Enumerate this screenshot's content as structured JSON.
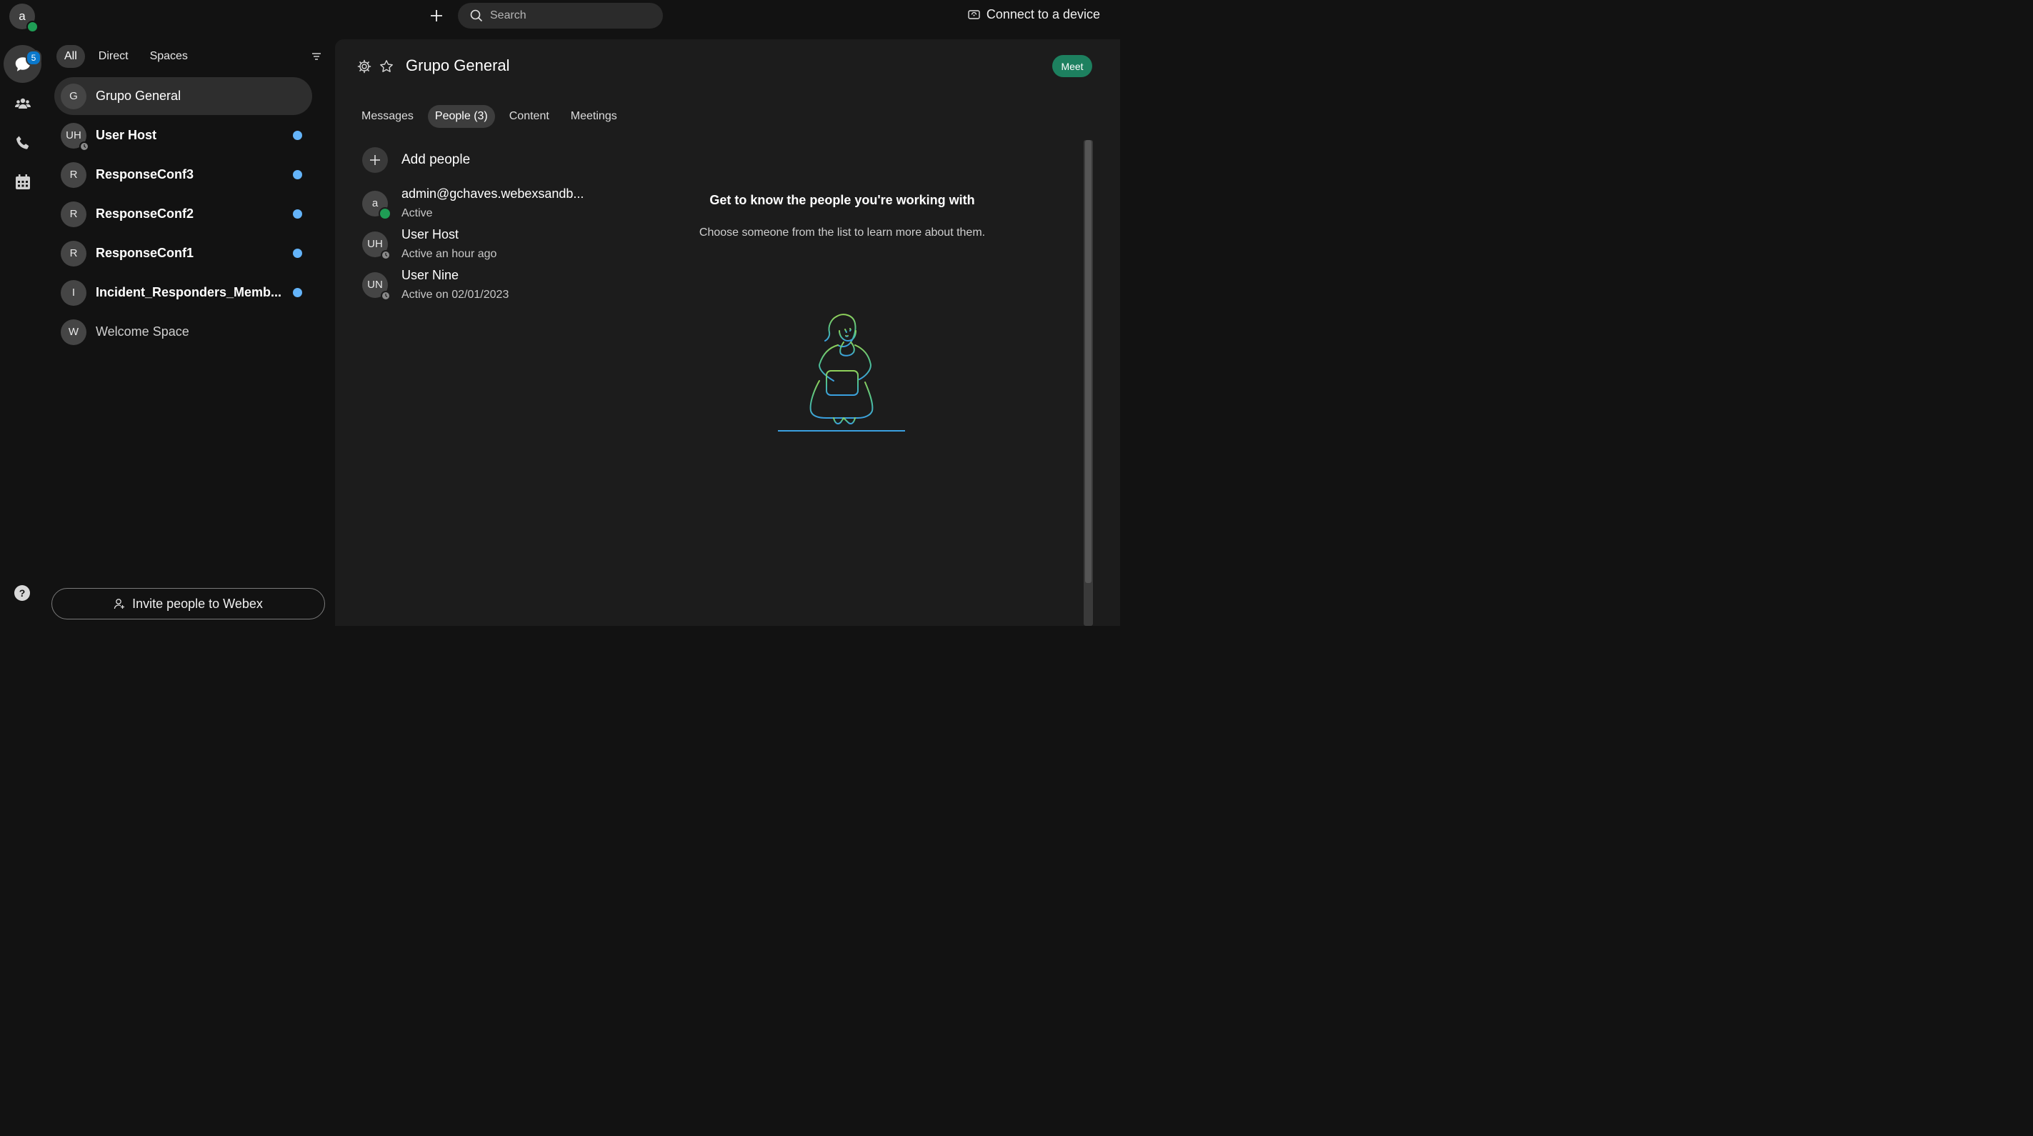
{
  "user": {
    "avatar_initial": "a"
  },
  "rail": {
    "messaging_badge": "5",
    "help_label": "?"
  },
  "topbar": {
    "search_placeholder": "Search",
    "connect_label": "Connect to a device"
  },
  "filters": [
    "All",
    "Direct",
    "Spaces"
  ],
  "spaces": [
    {
      "initials": "G",
      "name": "Grupo General",
      "bold": false,
      "unread": false,
      "selected": true
    },
    {
      "initials": "UH",
      "name": "User Host",
      "bold": true,
      "unread": true
    },
    {
      "initials": "R",
      "name": "ResponseConf3",
      "bold": true,
      "unread": true
    },
    {
      "initials": "R",
      "name": "ResponseConf2",
      "bold": true,
      "unread": true
    },
    {
      "initials": "R",
      "name": "ResponseConf1",
      "bold": true,
      "unread": true
    },
    {
      "initials": "I",
      "name": "Incident_Responders_Memb...",
      "bold": true,
      "unread": true
    },
    {
      "initials": "W",
      "name": "Welcome Space",
      "bold": false,
      "unread": false
    }
  ],
  "invite_label": "Invite people to Webex",
  "main": {
    "title": "Grupo General",
    "meet_label": "Meet",
    "tabs": [
      "Messages",
      "People (3)",
      "Content",
      "Meetings"
    ],
    "add_people_label": "Add people",
    "people": [
      {
        "initials": "a",
        "name": "admin@gchaves.webexsandb...",
        "status": "Active",
        "presence": "active"
      },
      {
        "initials": "UH",
        "name": "User Host",
        "status": "Active an hour ago",
        "presence": "away"
      },
      {
        "initials": "UN",
        "name": "User Nine",
        "status": "Active on 02/01/2023",
        "presence": "away"
      }
    ],
    "info_title": "Get to know the people you're working with",
    "info_subtitle": "Choose someone from the list to learn more about them."
  },
  "colors": {
    "accent_green": "#1d805f",
    "presence_green": "#1f9d55",
    "unread_blue": "#64b4fa",
    "badge_blue": "#0a78cc"
  }
}
